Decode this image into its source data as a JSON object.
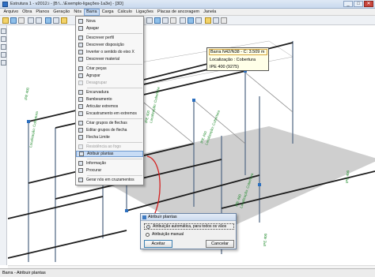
{
  "window": {
    "title": "Estrutura 1 - v2012.i - [B:\\...\\Exemplo-ligações-1a3e] - [3D]",
    "min": "_",
    "max": "□",
    "close": "✕"
  },
  "menu": [
    "Arquivo",
    "Obra",
    "Planos",
    "Geração",
    "Nós",
    "Barra",
    "Carga",
    "Cálculo",
    "Ligações",
    "Placas de ancoragem",
    "Janela"
  ],
  "barra_menu": {
    "items": [
      {
        "label": "Nova",
        "icon": "new-bar-icon",
        "disabled": false
      },
      {
        "label": "Apagar",
        "icon": "delete-bar-icon",
        "disabled": false
      },
      {
        "label": "Descrever perfil",
        "icon": "describe-profile-icon",
        "disabled": false
      },
      {
        "label": "Descrever disposição",
        "icon": "describe-layout-icon",
        "disabled": false
      },
      {
        "label": "Inverter o sentido do eixo X",
        "icon": "invert-axis-icon",
        "disabled": false
      },
      {
        "label": "Descrever material",
        "icon": "material-icon",
        "disabled": false
      },
      {
        "label": "Criar peças",
        "icon": "create-pieces-icon",
        "disabled": false
      },
      {
        "label": "Agrupar",
        "icon": "group-icon",
        "disabled": false
      },
      {
        "label": "Desagrupar",
        "icon": "ungroup-icon",
        "disabled": true
      },
      {
        "label": "Encurvadura",
        "icon": "buckling-icon",
        "disabled": false
      },
      {
        "label": "Bambeamento",
        "icon": "lateral-buckling-icon",
        "disabled": false
      },
      {
        "label": "Articular extremos",
        "icon": "articulate-ends-icon",
        "disabled": false
      },
      {
        "label": "Encastramento em extremos",
        "icon": "fixed-ends-icon",
        "disabled": false
      },
      {
        "label": "Criar grupos de flechas",
        "icon": "deflection-groups-icon",
        "disabled": false
      },
      {
        "label": "Editar grupos de flecha",
        "icon": "edit-deflection-icon",
        "disabled": false
      },
      {
        "label": "Flecha Limite",
        "icon": "limit-deflection-icon",
        "disabled": false
      },
      {
        "label": "Resistência ao fogo",
        "icon": "fire-resistance-icon",
        "disabled": true
      },
      {
        "label": "Atribuir plantas",
        "icon": "assign-floors-icon",
        "disabled": false,
        "highlighted": true
      },
      {
        "label": "Informação",
        "icon": "info-icon",
        "disabled": false
      },
      {
        "label": "Procurar",
        "icon": "search-icon",
        "disabled": false
      },
      {
        "label": "Gerar nós em cruzamentos",
        "icon": "generate-nodes-icon",
        "disabled": false
      }
    ]
  },
  "tooltip": {
    "bar": "Barra N42/N38 - C: 3.509 m",
    "location": "Localização : Cobertura",
    "profile": "IPE 400  (9275)"
  },
  "dialog": {
    "title": "Atribuir plantas",
    "option_auto": "Atribuição automática, para todos os vãos",
    "option_manual": "Atribuição manual",
    "accept": "Aceitar",
    "cancel": "Cancelar"
  },
  "profile_labels": [
    "IPE 400",
    "IPE 400",
    "IPE 400",
    "IPE 400",
    "IPE 400",
    "IPE 400"
  ],
  "location_labels": [
    "Localização: Cobertura",
    "Localização: Cobertura",
    "Localização: Cobertura",
    "Localização: Cobertura"
  ],
  "status": "Barra - Atribuir plantas",
  "colors": {
    "accent": "#3c7fb1",
    "label_green": "#1e8a2a",
    "arrow": "#d42020",
    "beam": "#1c1c1c",
    "column": "#5a6f8a"
  }
}
